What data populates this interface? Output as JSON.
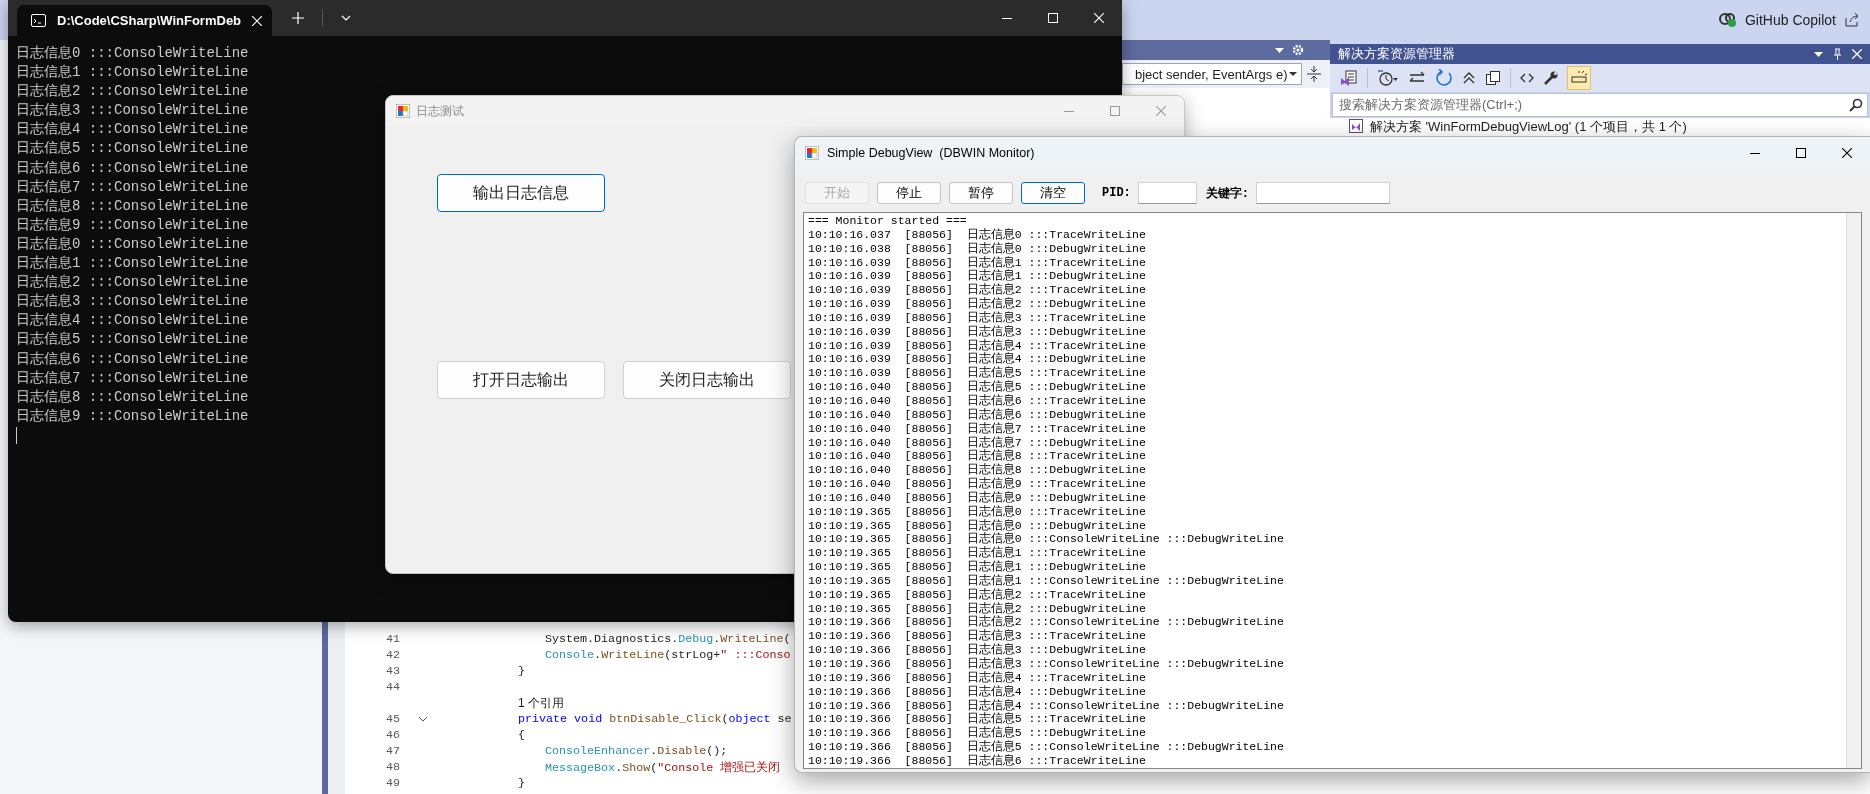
{
  "ide": {
    "account": "GitHub Copilot",
    "member_dropdown": "bject sender, EventArgs e)",
    "code": [
      {
        "kind": "statement",
        "number": "41",
        "tokens": [
          {
            "kind": "plain",
            "text": "System.Diagnostics."
          },
          {
            "kind": "type",
            "text": "Debug"
          },
          {
            "kind": "plain",
            "text": "."
          },
          {
            "kind": "method",
            "text": "WriteLine"
          },
          {
            "kind": "plain",
            "text": "("
          }
        ]
      },
      {
        "kind": "statement",
        "number": "42",
        "tokens": [
          {
            "kind": "type",
            "text": "Console"
          },
          {
            "kind": "plain",
            "text": "."
          },
          {
            "kind": "method",
            "text": "WriteLine"
          },
          {
            "kind": "plain",
            "text": "(strLog+"
          },
          {
            "kind": "string",
            "text": "\" :::Conso"
          }
        ]
      },
      {
        "kind": "member",
        "number": "43",
        "tokens": [
          {
            "kind": "plain",
            "text": "}"
          }
        ]
      },
      {
        "kind": "member",
        "number": "44"
      },
      {
        "kind": "codelens",
        "tokens": [
          {
            "kind": "plain",
            "text": "1 个引用"
          }
        ]
      },
      {
        "kind": "member",
        "number": "45",
        "tokens": [
          {
            "kind": "keyword",
            "text": "private void"
          },
          {
            "kind": "method",
            "text": " btnDisable_Click"
          },
          {
            "kind": "plain",
            "text": "("
          },
          {
            "kind": "keyword",
            "text": "object"
          },
          {
            "kind": "plain",
            "text": " se"
          }
        ]
      },
      {
        "kind": "member",
        "number": "46",
        "tokens": [
          {
            "kind": "plain",
            "text": "{"
          }
        ]
      },
      {
        "kind": "statement",
        "number": "47",
        "tokens": [
          {
            "kind": "type",
            "text": "ConsoleEnhancer"
          },
          {
            "kind": "plain",
            "text": "."
          },
          {
            "kind": "method",
            "text": "Disable"
          },
          {
            "kind": "plain",
            "text": "();"
          }
        ]
      },
      {
        "kind": "statement",
        "number": "48",
        "tokens": [
          {
            "kind": "type",
            "text": "MessageBox"
          },
          {
            "kind": "plain",
            "text": "."
          },
          {
            "kind": "method",
            "text": "Show"
          },
          {
            "kind": "plain",
            "text": "("
          },
          {
            "kind": "string",
            "text": "\"Console 增强已关闭"
          }
        ]
      },
      {
        "kind": "member",
        "number": "49",
        "tokens": [
          {
            "kind": "plain",
            "text": "}"
          }
        ]
      }
    ],
    "solution_explorer": {
      "title": "解决方案资源管理器",
      "search": {
        "placeholder": "搜索解决方案资源管理器(Ctrl+;)"
      },
      "tree": [
        {
          "label": "解决方案 'WinFormDebugViewLog' (1 个项目，共 1 个)"
        }
      ]
    }
  },
  "terminal": {
    "tab_title": "D:\\Code\\CSharp\\WinFormDeb",
    "lines": [
      "日志信息0 :::ConsoleWriteLine",
      "日志信息1 :::ConsoleWriteLine",
      "日志信息2 :::ConsoleWriteLine",
      "日志信息3 :::ConsoleWriteLine",
      "日志信息4 :::ConsoleWriteLine",
      "日志信息5 :::ConsoleWriteLine",
      "日志信息6 :::ConsoleWriteLine",
      "日志信息7 :::ConsoleWriteLine",
      "日志信息8 :::ConsoleWriteLine",
      "日志信息9 :::ConsoleWriteLine",
      "日志信息0 :::ConsoleWriteLine",
      "日志信息1 :::ConsoleWriteLine",
      "日志信息2 :::ConsoleWriteLine",
      "日志信息3 :::ConsoleWriteLine",
      "日志信息4 :::ConsoleWriteLine",
      "日志信息5 :::ConsoleWriteLine",
      "日志信息6 :::ConsoleWriteLine",
      "日志信息7 :::ConsoleWriteLine",
      "日志信息8 :::ConsoleWriteLine",
      "日志信息9 :::ConsoleWriteLine"
    ]
  },
  "form": {
    "title": "日志测试",
    "buttons": [
      {
        "label": "输出日志信息",
        "focused": true
      },
      {
        "label": "打开日志输出",
        "focused": false
      },
      {
        "label": "关闭日志输出",
        "focused": false
      }
    ]
  },
  "debugview": {
    "title": "Simple DebugView  (DBWIN Monitor)",
    "buttons": [
      {
        "label": "开始",
        "disabled": true,
        "focused": false
      },
      {
        "label": "停止",
        "disabled": false,
        "focused": false
      },
      {
        "label": "暂停",
        "disabled": false,
        "focused": false
      },
      {
        "label": "清空",
        "disabled": false,
        "focused": true
      }
    ],
    "pid": {
      "label": "PID:"
    },
    "keyword": {
      "label": "关键字:"
    },
    "log": [
      "=== Monitor started ===",
      "10:10:16.037  [88056]  日志信息0 :::TraceWriteLine",
      "10:10:16.038  [88056]  日志信息0 :::DebugWriteLine",
      "10:10:16.039  [88056]  日志信息1 :::TraceWriteLine",
      "10:10:16.039  [88056]  日志信息1 :::DebugWriteLine",
      "10:10:16.039  [88056]  日志信息2 :::TraceWriteLine",
      "10:10:16.039  [88056]  日志信息2 :::DebugWriteLine",
      "10:10:16.039  [88056]  日志信息3 :::TraceWriteLine",
      "10:10:16.039  [88056]  日志信息3 :::DebugWriteLine",
      "10:10:16.039  [88056]  日志信息4 :::TraceWriteLine",
      "10:10:16.039  [88056]  日志信息4 :::DebugWriteLine",
      "10:10:16.039  [88056]  日志信息5 :::TraceWriteLine",
      "10:10:16.040  [88056]  日志信息5 :::DebugWriteLine",
      "10:10:16.040  [88056]  日志信息6 :::TraceWriteLine",
      "10:10:16.040  [88056]  日志信息6 :::DebugWriteLine",
      "10:10:16.040  [88056]  日志信息7 :::TraceWriteLine",
      "10:10:16.040  [88056]  日志信息7 :::DebugWriteLine",
      "10:10:16.040  [88056]  日志信息8 :::TraceWriteLine",
      "10:10:16.040  [88056]  日志信息8 :::DebugWriteLine",
      "10:10:16.040  [88056]  日志信息9 :::TraceWriteLine",
      "10:10:16.040  [88056]  日志信息9 :::DebugWriteLine",
      "10:10:19.365  [88056]  日志信息0 :::TraceWriteLine",
      "10:10:19.365  [88056]  日志信息0 :::DebugWriteLine",
      "10:10:19.365  [88056]  日志信息0 :::ConsoleWriteLine :::DebugWriteLine",
      "10:10:19.365  [88056]  日志信息1 :::TraceWriteLine",
      "10:10:19.365  [88056]  日志信息1 :::DebugWriteLine",
      "10:10:19.365  [88056]  日志信息1 :::ConsoleWriteLine :::DebugWriteLine",
      "10:10:19.365  [88056]  日志信息2 :::TraceWriteLine",
      "10:10:19.365  [88056]  日志信息2 :::DebugWriteLine",
      "10:10:19.366  [88056]  日志信息2 :::ConsoleWriteLine :::DebugWriteLine",
      "10:10:19.366  [88056]  日志信息3 :::TraceWriteLine",
      "10:10:19.366  [88056]  日志信息3 :::DebugWriteLine",
      "10:10:19.366  [88056]  日志信息3 :::ConsoleWriteLine :::DebugWriteLine",
      "10:10:19.366  [88056]  日志信息4 :::TraceWriteLine",
      "10:10:19.366  [88056]  日志信息4 :::DebugWriteLine",
      "10:10:19.366  [88056]  日志信息4 :::ConsoleWriteLine :::DebugWriteLine",
      "10:10:19.366  [88056]  日志信息5 :::TraceWriteLine",
      "10:10:19.366  [88056]  日志信息5 :::DebugWriteLine",
      "10:10:19.366  [88056]  日志信息5 :::ConsoleWriteLine :::DebugWriteLine",
      "10:10:19.366  [88056]  日志信息6 :::TraceWriteLine"
    ]
  }
}
